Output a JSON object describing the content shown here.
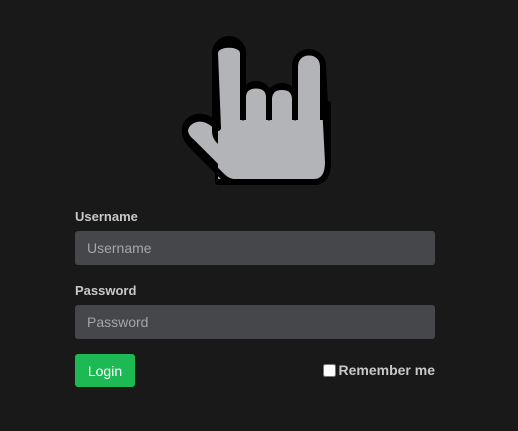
{
  "logo": {
    "icon": "rock-hand-icon",
    "colors": {
      "fill": "#b3b4b7",
      "outline": "#000000"
    }
  },
  "form": {
    "username": {
      "label": "Username",
      "placeholder": "Username",
      "value": ""
    },
    "password": {
      "label": "Password",
      "placeholder": "Password",
      "value": ""
    },
    "login_label": "Login",
    "remember_label": "Remember me",
    "remember_checked": false
  },
  "colors": {
    "background": "#191919",
    "input_bg": "#46474b",
    "accent": "#1db954",
    "label_text": "#c8c8c8"
  }
}
